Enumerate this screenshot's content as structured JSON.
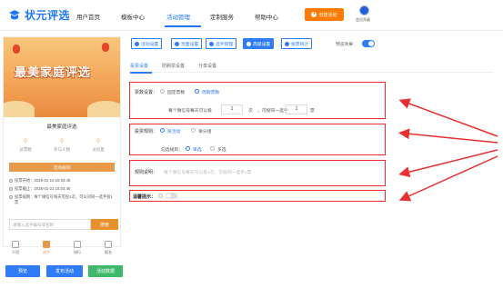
{
  "brand": {
    "name": "状元评选"
  },
  "nav": [
    {
      "label": "用户首页"
    },
    {
      "label": "模板中心"
    },
    {
      "label": "活动管理"
    },
    {
      "label": "定制服务"
    },
    {
      "label": "帮助中心"
    }
  ],
  "header": {
    "create_label": "创建活动",
    "member_label": "会员升级"
  },
  "activity": {
    "banner_title": "最美家庭评选",
    "name": "最美家庭评选",
    "stats": [
      {
        "value": "0",
        "label": "总票数"
      },
      {
        "value": "0",
        "label": "参与人数"
      },
      {
        "value": "0",
        "label": "访问量"
      }
    ],
    "vote_button": "活动规则",
    "info": [
      "投票开始：2025-01-16 15:03:45",
      "投票截止：2025-01-22 15:03:45",
      "投票规则：每个微信号每天可投1次，可以对同一选手投1票"
    ],
    "search_placeholder": "请输入选手编号或名称",
    "search_button": "搜索"
  },
  "bottom_nav": [
    {
      "label": "介绍"
    },
    {
      "label": "选手"
    },
    {
      "label": "排行"
    },
    {
      "label": "报名"
    }
  ],
  "footer_buttons": {
    "preview": "预览",
    "publish": "发布活动",
    "data": "活动数据"
  },
  "toolbar": [
    {
      "label": "活动设置"
    },
    {
      "label": "页面设置"
    },
    {
      "label": "选手管理"
    },
    {
      "label": "高级设置"
    },
    {
      "label": "投票统计"
    }
  ],
  "preview_label": "预览效果",
  "tabs": [
    {
      "label": "投票设置"
    },
    {
      "label": "防刷票设置"
    },
    {
      "label": "分享设置"
    }
  ],
  "settings": {
    "vote_count": {
      "label": "票数设置：",
      "options": [
        "固定票数",
        "周期票数"
      ],
      "selected": "周期票数",
      "prefix": "每个微信号每天可以投",
      "per_day": "1",
      "unit": "次",
      "mid": "，可投同一选手",
      "per_player": "1",
      "unit2": "票"
    },
    "vote_rule": {
      "label": "投票规则：",
      "options": [
        "投活动",
        "单分组"
      ],
      "selected": "投活动",
      "sub_label": "勾选规则：",
      "sub_options": [
        "单选",
        "多选"
      ],
      "sub_selected": "单选"
    },
    "rule_desc": {
      "label": "规则说明：",
      "placeholder": "每个微信号每天可以投1次，可投同一选手1票"
    },
    "warm_tip": {
      "label": "温馨提示："
    }
  }
}
